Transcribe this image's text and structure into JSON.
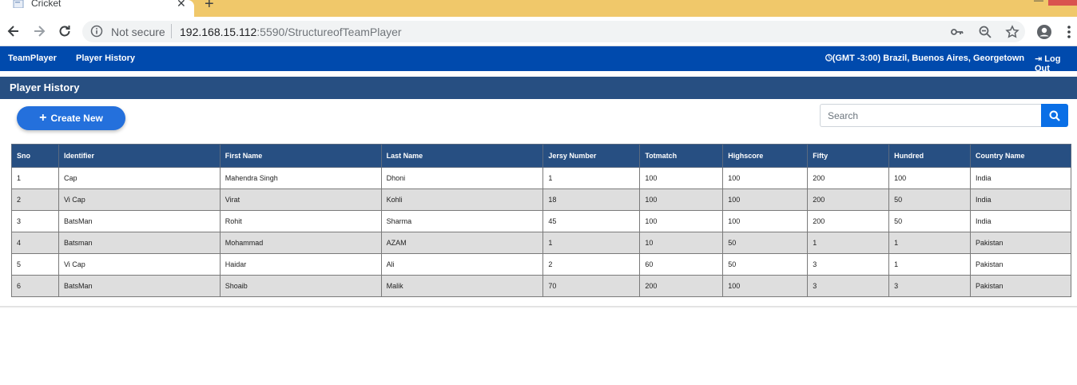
{
  "browser": {
    "tab_title": "Cricket",
    "security_label": "Not secure",
    "url_host": "192.168.15.112",
    "url_rest": ":5590/StructureofTeamPlayer"
  },
  "navbar": {
    "links": [
      "TeamPlayer",
      "Player History"
    ],
    "timezone": "(GMT -3:00) Brazil, Buenos Aires, Georgetown",
    "logout": "Log Out"
  },
  "page": {
    "section_title": "Player History",
    "create_label": "Create New",
    "search_placeholder": "Search"
  },
  "table": {
    "columns": [
      "Sno",
      "Identifier",
      "First Name",
      "Last Name",
      "Jersy Number",
      "Totmatch",
      "Highscore",
      "Fifty",
      "Hundred",
      "Country Name"
    ],
    "rows": [
      [
        "1",
        "Cap",
        "Mahendra Singh",
        "Dhoni",
        "1",
        "100",
        "100",
        "200",
        "100",
        "India"
      ],
      [
        "2",
        "Vi Cap",
        "Virat",
        "Kohli",
        "18",
        "100",
        "100",
        "200",
        "50",
        "India"
      ],
      [
        "3",
        "BatsMan",
        "Rohit",
        "Sharma",
        "45",
        "100",
        "100",
        "200",
        "50",
        "India"
      ],
      [
        "4",
        "Batsman",
        "Mohammad",
        "AZAM",
        "1",
        "10",
        "50",
        "1",
        "1",
        "Pakistan"
      ],
      [
        "5",
        "Vi Cap",
        "Haidar",
        "Ali",
        "2",
        "60",
        "50",
        "3",
        "1",
        "Pakistan"
      ],
      [
        "6",
        "BatsMan",
        "Shoaib",
        "Malik",
        "70",
        "200",
        "100",
        "3",
        "3",
        "Pakistan"
      ]
    ]
  },
  "colors": {
    "navbar": "#004aad",
    "section_header": "#274f82",
    "primary_button": "#2470dc",
    "tab_strip": "#f0c86a"
  }
}
